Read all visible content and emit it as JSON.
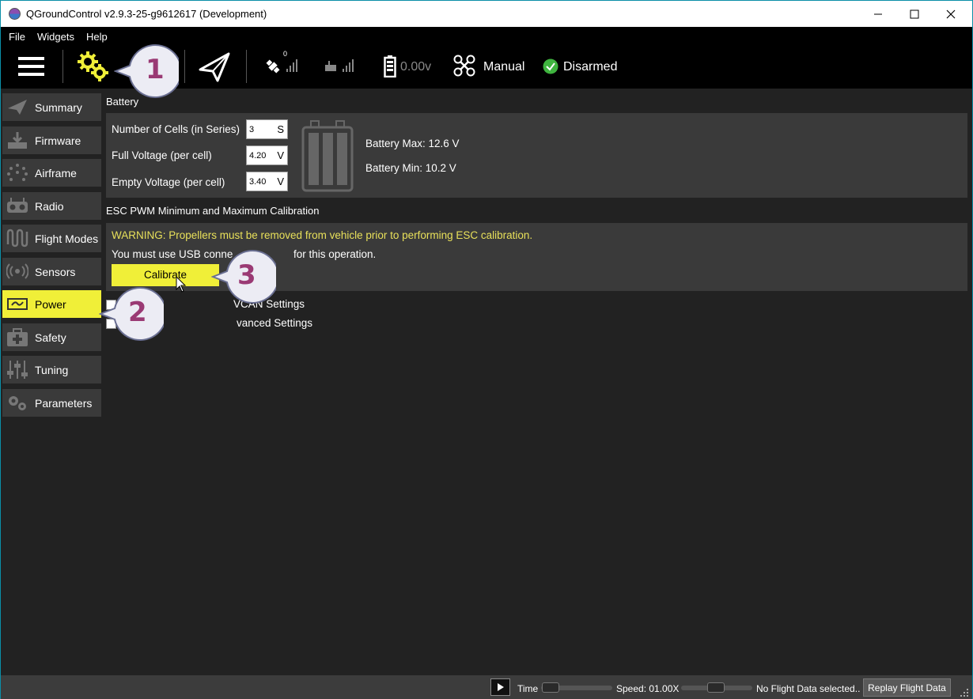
{
  "window": {
    "title": "QGroundControl v2.9.3-25-g9612617 (Development)",
    "frame_color": "#0a8fa8"
  },
  "menubar": {
    "items": [
      "File",
      "Widgets",
      "Help"
    ]
  },
  "toolbar": {
    "icons": [
      "hamburger-menu-icon",
      "vehicle-setup-gears-icon",
      "plan-paper-plane-icon",
      "gps-satellite-icon",
      "rc-signal-icon",
      "battery-icon",
      "drone-frame-icon",
      "check-circle-icon"
    ],
    "gps_count": "0",
    "battery_voltage": "0.00v",
    "flight_mode": "Manual",
    "arm_status": "Disarmed",
    "accent": "#f0ef38"
  },
  "sidebar": {
    "items": [
      {
        "label": "Summary",
        "icon": "paper-plane-icon",
        "active": false
      },
      {
        "label": "Firmware",
        "icon": "download-icon",
        "active": false
      },
      {
        "label": "Airframe",
        "icon": "dotted-circle-icon",
        "active": false
      },
      {
        "label": "Radio",
        "icon": "rc-transmitter-icon",
        "active": false
      },
      {
        "label": "Flight Modes",
        "icon": "wave-icon",
        "active": false
      },
      {
        "label": "Sensors",
        "icon": "radio-waves-icon",
        "active": false
      },
      {
        "label": "Power",
        "icon": "power-plug-icon",
        "active": true
      },
      {
        "label": "Safety",
        "icon": "first-aid-kit-icon",
        "active": false
      },
      {
        "label": "Tuning",
        "icon": "sliders-icon",
        "active": false
      },
      {
        "label": "Parameters",
        "icon": "gears-icon",
        "active": false
      }
    ]
  },
  "battery": {
    "section_title": "Battery",
    "cells_label": "Number of Cells (in Series)",
    "cells_value": "3",
    "cells_unit": "S",
    "full_label": "Full Voltage (per cell)",
    "full_value": "4.20",
    "full_unit": "V",
    "empty_label": "Empty Voltage (per cell)",
    "empty_value": "3.40",
    "empty_unit": "V",
    "max_text": "Battery Max: 12.6 V",
    "min_text": "Battery Min:  10.2 V"
  },
  "esc": {
    "section_title": "ESC PWM Minimum and Maximum Calibration",
    "warning": "WARNING: Propellers must be removed from vehicle prior to performing ESC calibration.",
    "usb_note": "You must use USB conne",
    "usb_note_tail": "for this operation.",
    "calibrate_label": "Calibrate"
  },
  "options": {
    "uavcan_label": "VCAN Settings",
    "advanced_label": "vanced Settings"
  },
  "callouts": [
    "1",
    "2",
    "3"
  ],
  "bottombar": {
    "time_label": "Time",
    "speed_label": "Speed: 01.00X",
    "status": "No Flight Data selected..",
    "replay_label": "Replay Flight Data"
  }
}
